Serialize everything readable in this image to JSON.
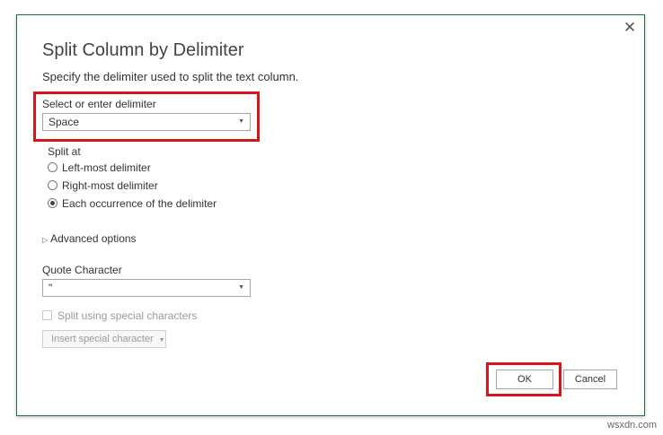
{
  "dialog": {
    "title": "Split Column by Delimiter",
    "description": "Specify the delimiter used to split the text column.",
    "close_glyph": "✕"
  },
  "delimiter": {
    "label": "Select or enter delimiter",
    "value": "Space",
    "arrow_glyph": "▼"
  },
  "split_at": {
    "label": "Split at",
    "options": [
      {
        "label": "Left-most delimiter",
        "checked": false
      },
      {
        "label": "Right-most delimiter",
        "checked": false
      },
      {
        "label": "Each occurrence of the delimiter",
        "checked": true
      }
    ]
  },
  "advanced": {
    "label": "Advanced options",
    "glyph": "▷"
  },
  "quote": {
    "label": "Quote Character",
    "value": "\""
  },
  "special": {
    "checkbox_label": "Split using special characters",
    "insert_label": "Insert special character"
  },
  "buttons": {
    "ok": "OK",
    "cancel": "Cancel"
  },
  "watermark": "wsxdn.com",
  "colors": {
    "highlight": "#d7141a",
    "dialog_border": "#217346"
  }
}
